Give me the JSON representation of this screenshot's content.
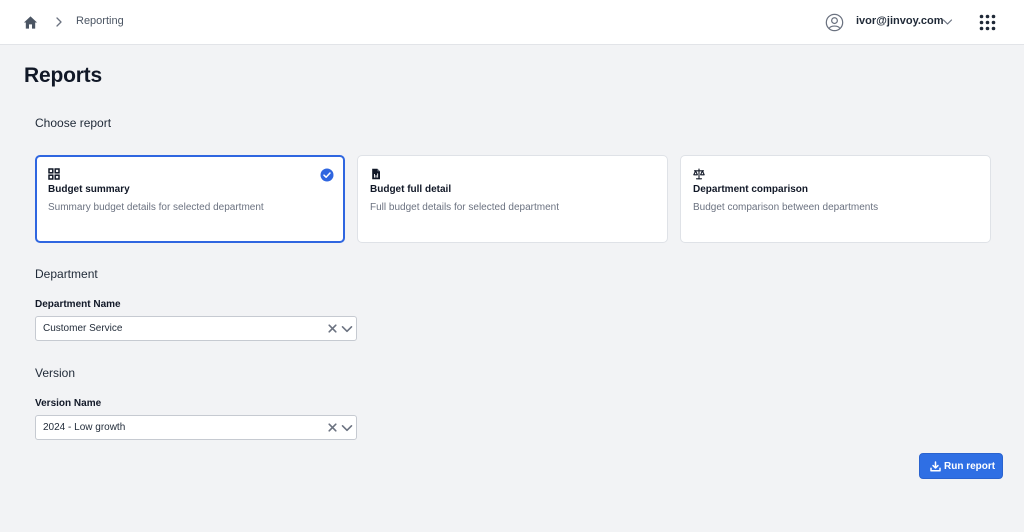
{
  "header": {
    "breadcrumb": {
      "current": "Reporting"
    },
    "user": {
      "email": "ivor@jinvoy.com"
    },
    "icons": [
      "home-icon",
      "chevron-right-icon",
      "user-circle-icon",
      "chevron-down-icon",
      "apps-grid-icon"
    ]
  },
  "page": {
    "title": "Reports",
    "choose_report_label": "Choose report"
  },
  "report_options": [
    {
      "icon": "grid-icon",
      "title": "Budget summary",
      "description": "Summary budget details for selected department",
      "selected": true
    },
    {
      "icon": "document-icon",
      "title": "Budget full detail",
      "description": "Full budget details for selected department",
      "selected": false
    },
    {
      "icon": "scale-icon",
      "title": "Department comparison",
      "description": "Budget comparison between departments",
      "selected": false
    }
  ],
  "department": {
    "section_title": "Department",
    "field_label": "Department Name",
    "value": "Customer Service"
  },
  "version": {
    "section_title": "Version",
    "field_label": "Version Name",
    "value": "2024 - Low growth"
  },
  "actions": {
    "run_label": "Run report"
  },
  "colors": {
    "accent": "#2f6fe4",
    "background": "#f2f3f5",
    "card_selected_border": "#2f66e0"
  }
}
